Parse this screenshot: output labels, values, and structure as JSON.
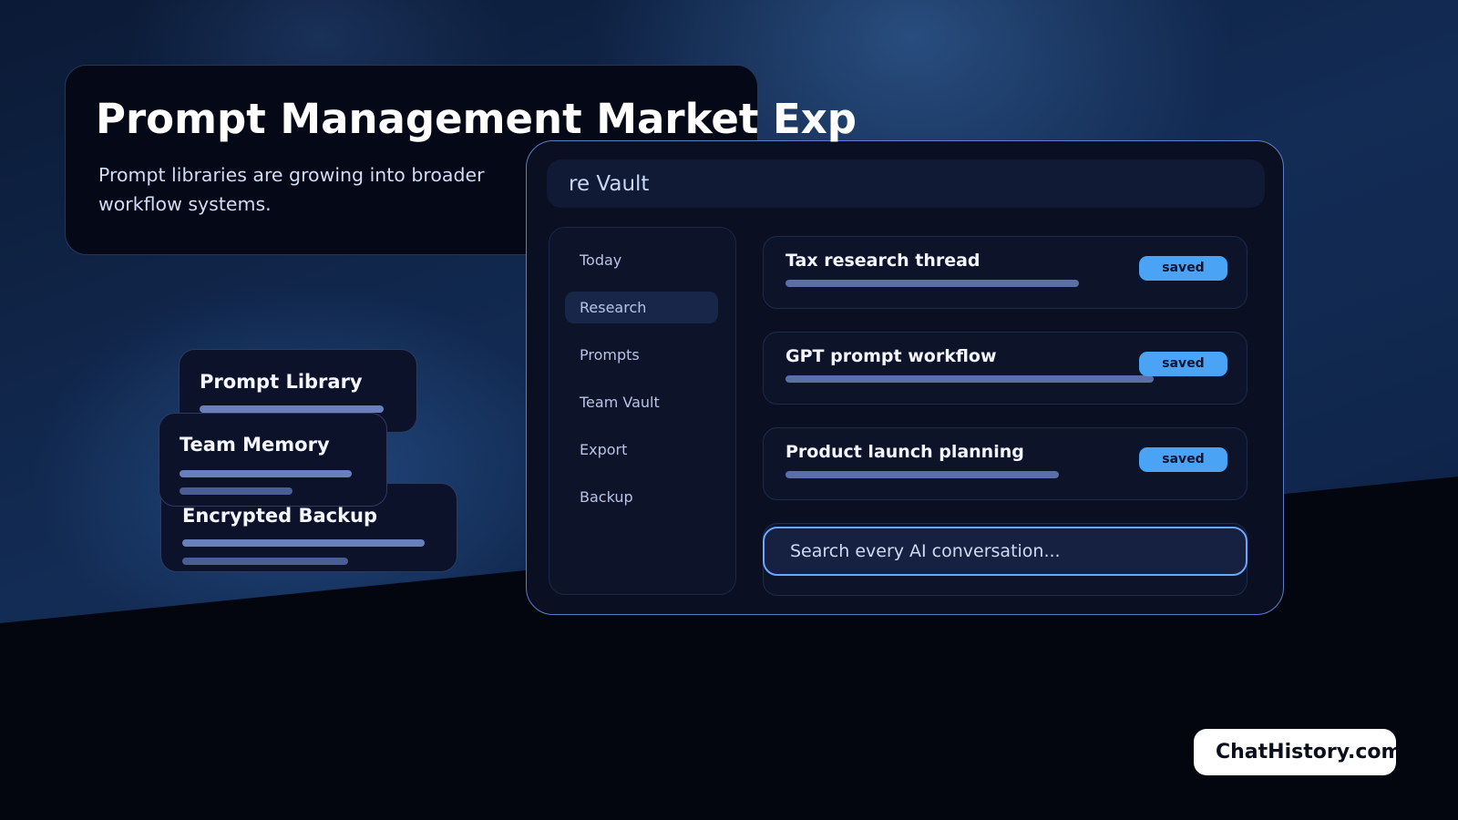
{
  "hero": {
    "title": "Prompt Management Market Exp",
    "subtitle": "Prompt libraries are growing into broader workflow systems."
  },
  "app": {
    "title": "re Vault",
    "sidebar": {
      "items": [
        {
          "label": "Today",
          "active": false
        },
        {
          "label": "Research",
          "active": true
        },
        {
          "label": "Prompts",
          "active": false
        },
        {
          "label": "Team Vault",
          "active": false
        },
        {
          "label": "Export",
          "active": false
        },
        {
          "label": "Backup",
          "active": false
        }
      ]
    },
    "threads": [
      {
        "title": "Tax research thread",
        "badge": "saved"
      },
      {
        "title": "GPT prompt workflow",
        "badge": "saved"
      },
      {
        "title": "Product launch planning",
        "badge": "saved"
      }
    ],
    "search": {
      "placeholder": "Search every AI conversation..."
    }
  },
  "feature_cards": [
    {
      "title": "Prompt Library"
    },
    {
      "title": "Team Memory"
    },
    {
      "title": "Encrypted Backup"
    }
  ],
  "brand": {
    "label": "ChatHistory.com"
  },
  "colors": {
    "accent": "#4aa3f5",
    "focus_border": "#6da6ff",
    "app_border": "#5e7cc7",
    "background": "#03060f"
  }
}
